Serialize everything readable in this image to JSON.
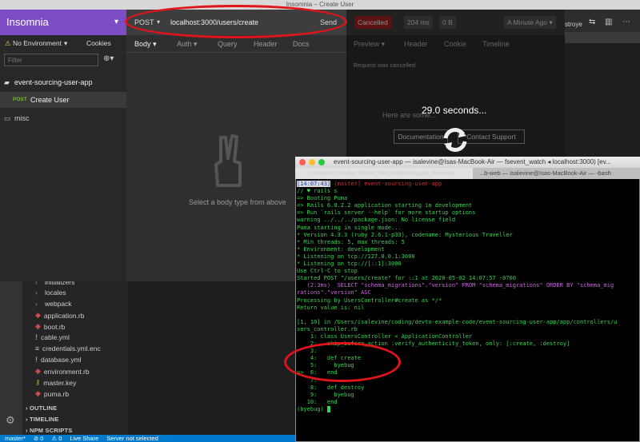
{
  "window": {
    "title": "Insomnia – Create User"
  },
  "insomnia": {
    "brand": "Insomnia",
    "environment": "No Environment",
    "cookies": "Cookies",
    "filter_placeholder": "Filter",
    "workspace": "event-sourcing-user-app",
    "request": {
      "method": "POST",
      "name": "Create User"
    },
    "folder": "misc",
    "url": {
      "method": "POST",
      "value": "localhost:3000/users/create",
      "send": "Send"
    },
    "tabs": [
      "Body",
      "Auth",
      "Query",
      "Header",
      "Docs"
    ],
    "empty_body": "Select a body type from above",
    "response": {
      "status": "Cancelled",
      "time": "204 ms",
      "size": "0 B",
      "when": "A Minute Ago",
      "tabs": [
        "Preview",
        "Header",
        "Cookie",
        "Timeline"
      ],
      "message": "Request was cancelled",
      "timer": "29.0 seconds...",
      "hint": "Here are some...",
      "doc_btn": "Documentation",
      "support_btn": "Contact Support"
    }
  },
  "vscode": {
    "right_text": "stroye",
    "tree": [
      {
        "name": "initializers",
        "kind": "folder"
      },
      {
        "name": "locales",
        "kind": "folder"
      },
      {
        "name": "webpack",
        "kind": "folder"
      },
      {
        "name": "application.rb",
        "kind": "ruby"
      },
      {
        "name": "boot.rb",
        "kind": "ruby"
      },
      {
        "name": "cable.yml",
        "kind": "yml"
      },
      {
        "name": "credentials.yml.enc",
        "kind": "lock"
      },
      {
        "name": "database.yml",
        "kind": "yml"
      },
      {
        "name": "environment.rb",
        "kind": "ruby"
      },
      {
        "name": "master.key",
        "kind": "key"
      },
      {
        "name": "puma.rb",
        "kind": "ruby"
      }
    ],
    "sections": [
      "OUTLINE",
      "TIMELINE",
      "NPM SCRIPTS"
    ],
    "status": [
      "master*",
      "⊘ 0",
      "⚠ 0",
      "Live Share",
      "Server not selected"
    ]
  },
  "terminal": {
    "title": "event-sourcing-user-app — isalevine@Isas-MacBook-Air — fsevent_watch ◂ localhost:3000) [ev...",
    "tab1": "...salevine/.rvm/bin TERM_PROGRAM=Apple_Terminal",
    "tab2": "...b-web — isalevine@Isas-MacBook-Air — -bash",
    "lines": [
      {
        "t": "[14:07:43] (master) event-sourcing-user-app",
        "c": "prompt"
      },
      {
        "t": "// ♥ rails s",
        "c": "g"
      },
      {
        "t": "=> Booting Puma",
        "c": "g"
      },
      {
        "t": "=> Rails 6.0.2.2 application starting in development",
        "c": "g"
      },
      {
        "t": "=> Run `rails server --help` for more startup options",
        "c": "g"
      },
      {
        "t": "warning ../../../package.json: No license field",
        "c": "g"
      },
      {
        "t": "Puma starting in single mode...",
        "c": "g"
      },
      {
        "t": "* Version 4.3.3 (ruby 2.6.1-p33), codename: Mysterious Traveller",
        "c": "g"
      },
      {
        "t": "* Min threads: 5, max threads: 5",
        "c": "g"
      },
      {
        "t": "* Environment: development",
        "c": "g"
      },
      {
        "t": "* Listening on tcp://127.0.0.1:3000",
        "c": "g"
      },
      {
        "t": "* Listening on tcp://[::1]:3000",
        "c": "g"
      },
      {
        "t": "Use Ctrl-C to stop",
        "c": "g"
      },
      {
        "t": "Started POST \"/users/create\" for ::1 at 2020-05-02 14:07:57 -0700",
        "c": "g"
      },
      {
        "t": "   (2.3ms)  SELECT \"schema_migrations\".\"version\" FROM \"schema_migrations\" ORDER BY \"schema_mig",
        "c": "sql"
      },
      {
        "t": "rations\".\"version\" ASC",
        "c": "sql"
      },
      {
        "t": "Processing by UsersController#create as */*",
        "c": "g"
      },
      {
        "t": "Return value is: nil",
        "c": "g"
      },
      {
        "t": "",
        "c": "g"
      },
      {
        "t": "[1, 10] in /Users/isalevine/coding/devto-example-code/event-sourcing-user-app/app/controllers/u",
        "c": "g"
      },
      {
        "t": "sers_controller.rb",
        "c": "g"
      },
      {
        "t": "    1: class UsersController < ApplicationController",
        "c": "g"
      },
      {
        "t": "    2:   skip_before_action :verify_authenticity_token, only: [:create, :destroy]",
        "c": "g"
      },
      {
        "t": "    3:",
        "c": "g"
      },
      {
        "t": "    4:   def create",
        "c": "g"
      },
      {
        "t": "    5:     byebug",
        "c": "g"
      },
      {
        "t": "=>  6:   end",
        "c": "g"
      },
      {
        "t": "    7:",
        "c": "g"
      },
      {
        "t": "    8:   def destroy",
        "c": "g"
      },
      {
        "t": "    9:     byebug",
        "c": "g"
      },
      {
        "t": "   10:   end",
        "c": "g"
      },
      {
        "t": "(byebug) ",
        "c": "g"
      }
    ]
  },
  "colors": {
    "purple": "#7c4dc4",
    "green": "#39d353",
    "annotation": "#e0141b",
    "statusbar": "#007acc",
    "magenta": "#c86ad9"
  }
}
